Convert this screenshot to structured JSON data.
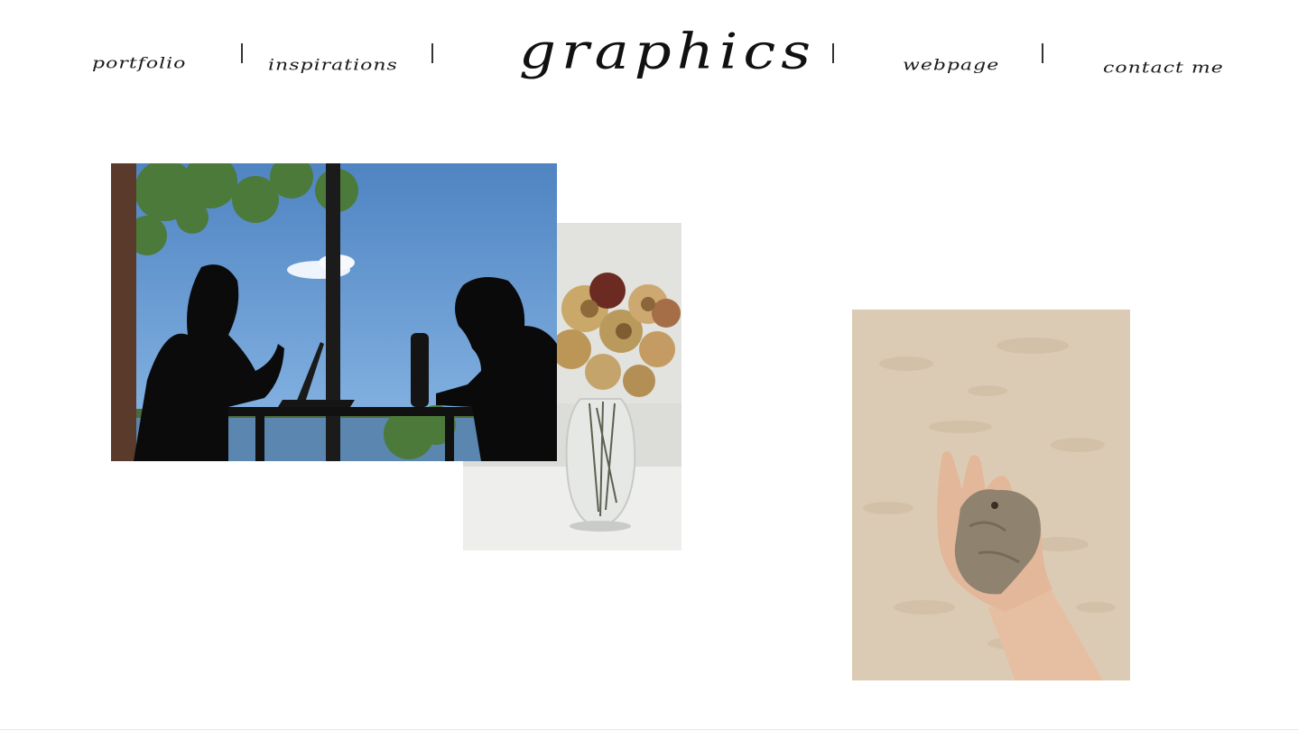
{
  "nav": {
    "logo": "graphics",
    "items": [
      {
        "label": "portfolio"
      },
      {
        "label": "inspirations"
      },
      {
        "label": "webpage"
      },
      {
        "label": "contact me"
      }
    ]
  },
  "gallery": {
    "photos": [
      {
        "name": "silhouette-photo",
        "icon": "two people silhouetted at a window table"
      },
      {
        "name": "dried-roses-photo",
        "icon": "dried roses in glass vase"
      },
      {
        "name": "hand-stone-photo",
        "icon": "hand holding a stone on sand"
      }
    ]
  },
  "colors": {
    "background": "#ffffff",
    "text": "#1a1a1a",
    "sky": "#5f93cc",
    "sand": "#dccbb4"
  }
}
